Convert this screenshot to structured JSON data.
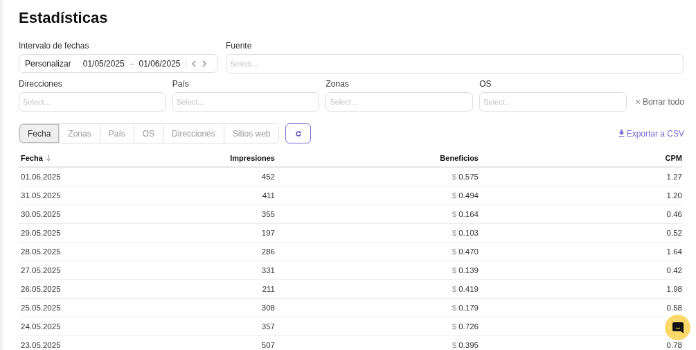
{
  "title": "Estadísticas",
  "date_range": {
    "label": "Intervalo de fechas",
    "preset": "Personalizar",
    "start": "01/05/2025",
    "separator": "–",
    "end": "01/06/2025"
  },
  "filters": [
    {
      "label": "Fuente",
      "placeholder": "Select..."
    },
    {
      "label": "Direcciones",
      "placeholder": "Select..."
    },
    {
      "label": "País",
      "placeholder": "Select..."
    },
    {
      "label": "Zonas",
      "placeholder": "Select..."
    },
    {
      "label": "OS",
      "placeholder": "Select..."
    }
  ],
  "clear_all": "Borrar todo",
  "group_tabs": [
    {
      "label": "Fecha",
      "selected": true
    },
    {
      "label": "Zonas",
      "selected": false
    },
    {
      "label": "País",
      "selected": false
    },
    {
      "label": "OS",
      "selected": false
    },
    {
      "label": "Direcciones",
      "selected": false
    },
    {
      "label": "Sitios web",
      "selected": false
    }
  ],
  "export": "Exportar a CSV",
  "table": {
    "columns": [
      {
        "label": "Fecha",
        "sorted": true
      },
      {
        "label": "Impresiones",
        "sorted": false
      },
      {
        "label": "Beneficios",
        "sorted": false
      },
      {
        "label": "CPM",
        "sorted": false
      }
    ],
    "rows": [
      {
        "date": "01.06.2025",
        "impressions": "452",
        "currency": "$",
        "revenue": "0.575",
        "cpm": "1.27"
      },
      {
        "date": "31.05.2025",
        "impressions": "411",
        "currency": "$",
        "revenue": "0.494",
        "cpm": "1.20"
      },
      {
        "date": "30.05.2025",
        "impressions": "355",
        "currency": "$",
        "revenue": "0.164",
        "cpm": "0.46"
      },
      {
        "date": "29.05.2025",
        "impressions": "197",
        "currency": "$",
        "revenue": "0.103",
        "cpm": "0.52"
      },
      {
        "date": "28.05.2025",
        "impressions": "286",
        "currency": "$",
        "revenue": "0.470",
        "cpm": "1.64"
      },
      {
        "date": "27.05.2025",
        "impressions": "331",
        "currency": "$",
        "revenue": "0.139",
        "cpm": "0.42"
      },
      {
        "date": "26.05.2025",
        "impressions": "211",
        "currency": "$",
        "revenue": "0.419",
        "cpm": "1.98"
      },
      {
        "date": "25.05.2025",
        "impressions": "308",
        "currency": "$",
        "revenue": "0.179",
        "cpm": "0.58"
      },
      {
        "date": "24.05.2025",
        "impressions": "357",
        "currency": "$",
        "revenue": "0.726"
      },
      {
        "date": "23.05.2025",
        "impressions": "507",
        "currency": "$",
        "revenue": "0.395",
        "cpm": "0.78"
      }
    ]
  }
}
